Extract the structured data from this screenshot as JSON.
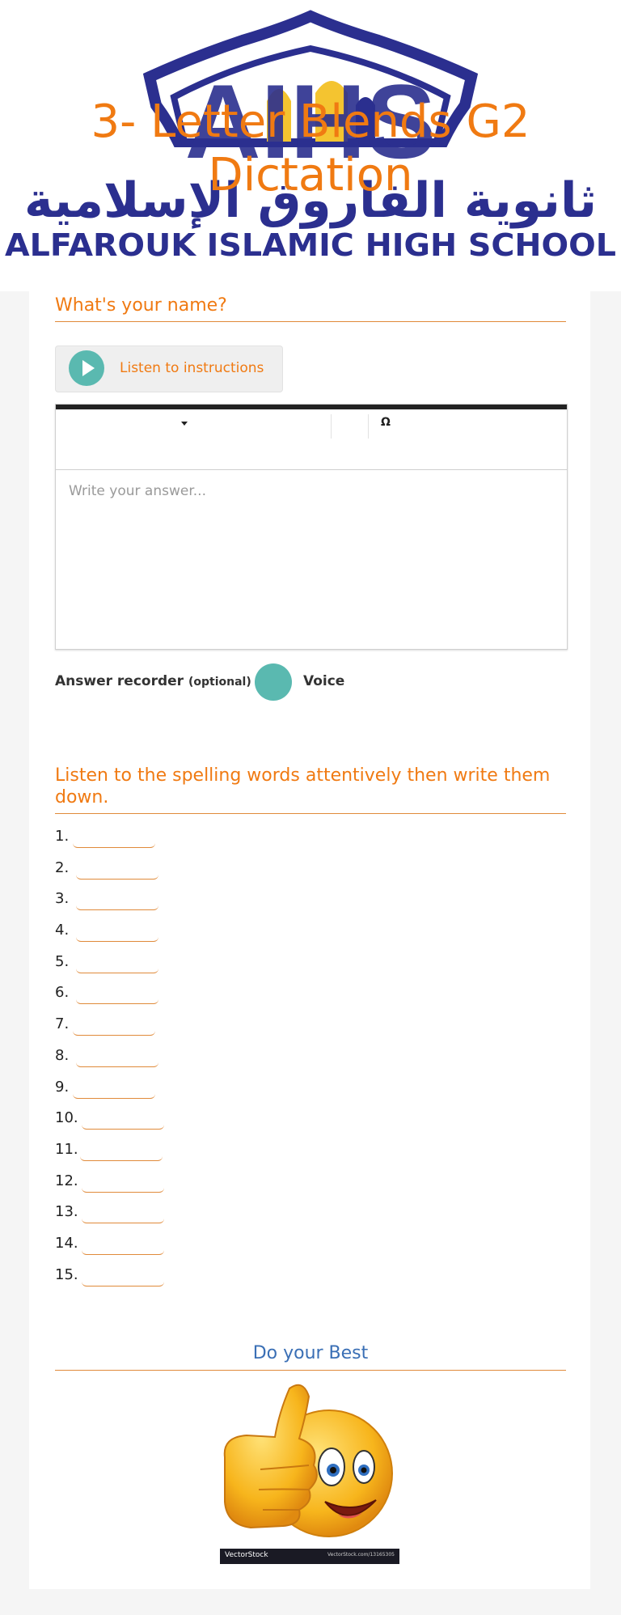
{
  "header": {
    "school_name_arabic": "ثانوية الفاروق الإسلامية",
    "school_name_english": "ALFAROUK ISLAMIC HIGH SCHOOL",
    "logo_letters": "AIHS",
    "title": "3- Letter Blends G2 Dictation"
  },
  "name_question": {
    "title": "What's your name?",
    "listen_label": "Listen to instructions",
    "editor": {
      "special_char_symbol": "Ω",
      "placeholder": "Write your answer..."
    },
    "recorder": {
      "label": "Answer recorder",
      "optional": "(optional) -",
      "voice_label": "Voice"
    }
  },
  "spelling_question": {
    "title": "Listen to the spelling words attentively then write them down.",
    "items": [
      "1.",
      "2.",
      "3.",
      "4.",
      "5.",
      "6.",
      "7.",
      "8.",
      "9.",
      "10.",
      "11.",
      "12.",
      "13.",
      "14.",
      "15."
    ]
  },
  "closing": {
    "title": "Do your Best",
    "watermark_brand": "VectorStock",
    "watermark_url": "VectorStock.com/13165305"
  },
  "colors": {
    "accent_orange": "#f07a12",
    "teal": "#5ab9b0",
    "blue_title": "#3a6fb5",
    "logo_blue": "#2b2f8f",
    "logo_gold": "#f4c430"
  },
  "icons": [
    "play-icon",
    "caret-down-icon",
    "omega-icon",
    "thumbs-up-emoji"
  ]
}
